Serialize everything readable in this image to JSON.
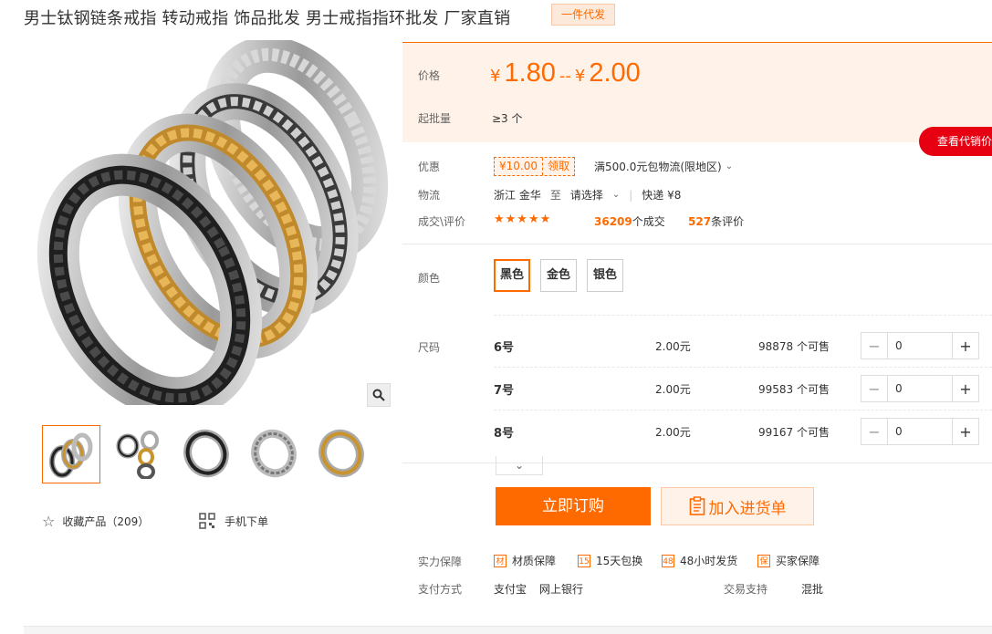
{
  "product": {
    "title": "男士钛钢链条戒指 转动戒指 饰品批发 男士戒指指环批发 厂家直销",
    "tag": "一件代发",
    "favorite_label": "收藏产品（209）",
    "mobile_order_label": "手机下单"
  },
  "price": {
    "label": "价格",
    "yen": "¥",
    "low": "1.80",
    "sep": "--",
    "high": "2.00",
    "moq_label": "起批量",
    "moq_value": "≥3 个",
    "agent_button": "查看代销价"
  },
  "promo": {
    "label": "优惠",
    "coupon_amount": "¥10.00",
    "coupon_action": "领取",
    "shipping_offer": "满500.0元包物流(限地区)"
  },
  "logistics": {
    "label": "物流",
    "from": "浙江 金华",
    "to_word": "至",
    "to_select": "请选择",
    "express": "快递 ¥8"
  },
  "deals": {
    "label": "成交\\评价",
    "stars": "★★★★★",
    "orders_count": "36209",
    "orders_suffix": "个成交",
    "reviews_count": "527",
    "reviews_suffix": "条评价"
  },
  "colors": {
    "label": "颜色",
    "options": [
      "黑色",
      "金色",
      "银色"
    ],
    "selected": "黑色"
  },
  "sizes": {
    "label": "尺码",
    "rows": [
      {
        "name": "6号",
        "price": "2.00元",
        "stock": "98878 个可售",
        "qty": "0"
      },
      {
        "name": "7号",
        "price": "2.00元",
        "stock": "99583 个可售",
        "qty": "0"
      },
      {
        "name": "8号",
        "price": "2.00元",
        "stock": "99167 个可售",
        "qty": "0"
      }
    ]
  },
  "actions": {
    "buy_now": "立即订购",
    "add_to_cart": "加入进货单"
  },
  "guarantees": {
    "label": "实力保障",
    "items": [
      {
        "icon": "材",
        "text": "材质保障"
      },
      {
        "icon": "15",
        "text": "15天包换"
      },
      {
        "icon": "48",
        "text": "48小时发货"
      },
      {
        "icon": "保",
        "text": "买家保障"
      }
    ]
  },
  "payment": {
    "label": "支付方式",
    "methods": [
      "支付宝",
      "网上银行"
    ],
    "trade_label": "交易支持",
    "trade_value": "混批"
  },
  "theme": {
    "accent": "#ff6a00",
    "agent_red": "#e60012",
    "panel_bg": "#fff2e8"
  },
  "icons": [
    "star-icon",
    "qr-icon",
    "zoom-icon",
    "chevron-down-icon",
    "minus-icon",
    "plus-icon",
    "cart-list-icon"
  ]
}
